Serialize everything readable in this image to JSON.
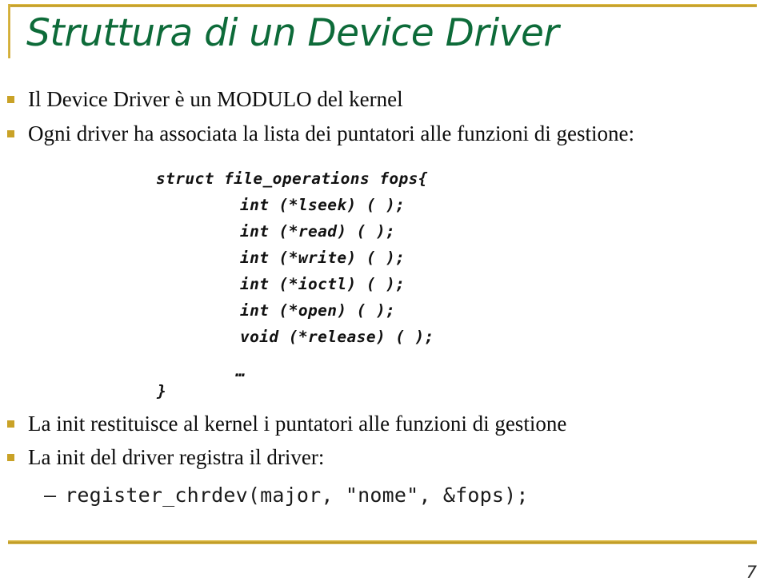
{
  "slide": {
    "title": "Struttura di un Device Driver",
    "page_number": "7",
    "accent_gold": "#c9a227",
    "title_green": "#0d6b39",
    "bullet_marker_icon": "square-bullet-icon",
    "dash_marker": "–"
  },
  "bullets": [
    {
      "text": "Il Device Driver è un MODULO del kernel"
    },
    {
      "text": "Ogni driver ha associata la lista dei puntatori alle funzioni di gestione:"
    },
    {
      "text": "La init restituisce al kernel i puntatori alle funzioni di gestione"
    },
    {
      "text": "La init del driver registra il driver:"
    }
  ],
  "code_block": {
    "lines": [
      "struct file_operations fops{",
      "int (*lseek) ( );",
      "int (*read) ( );",
      "int (*write) ( );",
      "int (*ioctl) ( );",
      "int (*open) ( );",
      "void (*release) ( );",
      "…",
      "}"
    ]
  },
  "sub_bullets": [
    {
      "marker": "–",
      "code": "register_chrdev(major, \"nome\", &fops);"
    }
  ]
}
